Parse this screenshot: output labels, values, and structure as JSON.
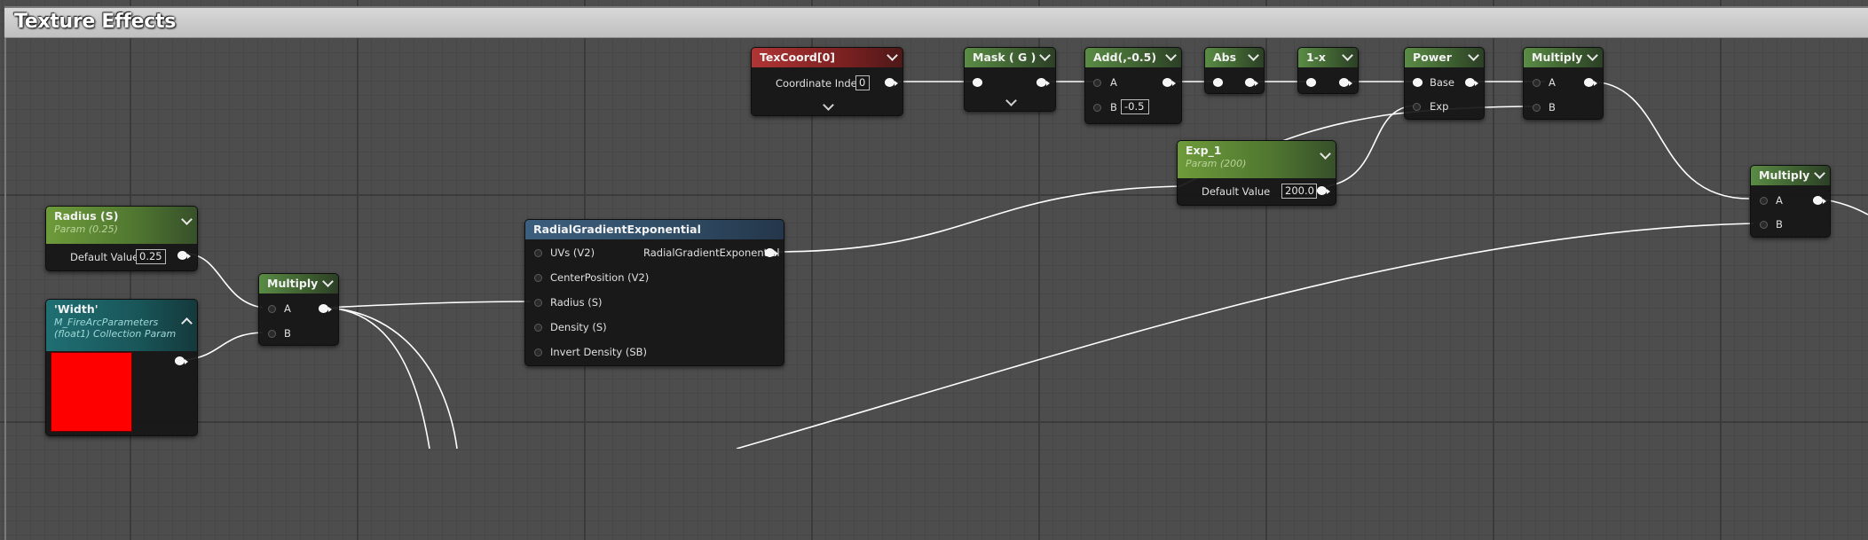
{
  "comment": {
    "title": "Texture Effects"
  },
  "colors": {
    "header_green": "#4f7a3b",
    "header_red": "#8e2929",
    "header_blue": "#35556f",
    "header_teal": "#1a5d60",
    "wire": "#ffffff",
    "swatch": "#ff0000"
  },
  "icons": {
    "collapse": "chevron-down-icon",
    "expand": "chevron-up-icon",
    "pin": "pin-icon"
  },
  "nodes": {
    "texcoord": {
      "title": "TexCoord[0]",
      "coord_label": "Coordinate Index",
      "coord_value": "0"
    },
    "mask": {
      "title": "Mask ( G )"
    },
    "add": {
      "title": "Add(,-0.5)",
      "a": "A",
      "b": "B",
      "b_value": "-0.5"
    },
    "abs": {
      "title": "Abs"
    },
    "oneminus": {
      "title": "1-x"
    },
    "power": {
      "title": "Power",
      "base": "Base",
      "exp": "Exp"
    },
    "multiply1": {
      "title": "Multiply",
      "a": "A",
      "b": "B"
    },
    "exp1": {
      "title": "Exp_1",
      "subtitle": "Param (200)",
      "default_label": "Default Value",
      "default_value": "200.0"
    },
    "multiply2": {
      "title": "Multiply",
      "a": "A",
      "b": "B"
    },
    "radius": {
      "title": "Radius (S)",
      "subtitle": "Param (0.25)",
      "default_label": "Default Value",
      "default_value": "0.25"
    },
    "multiply3": {
      "title": "Multiply",
      "a": "A",
      "b": "B"
    },
    "width": {
      "title": "'Width'",
      "subtitle1": "M_FireArcParameters",
      "subtitle2": "(float1) Collection Param"
    },
    "radial": {
      "title": "RadialGradientExponential",
      "inputs": [
        "UVs (V2)",
        "CenterPosition (V2)",
        "Radius (S)",
        "Density (S)",
        "Invert Density (SB)"
      ],
      "output": "RadialGradientExponential"
    }
  }
}
